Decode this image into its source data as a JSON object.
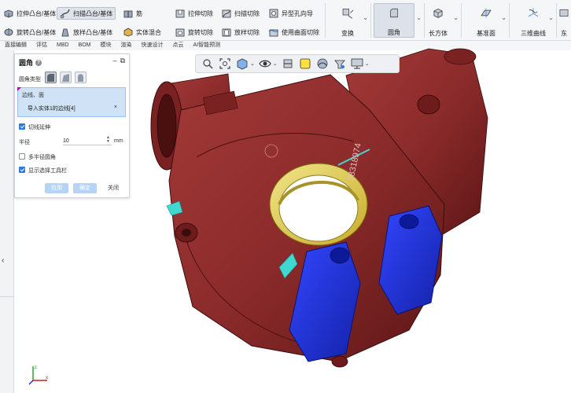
{
  "ribbon": {
    "row1": [
      {
        "label": "拉伸凸台/基体",
        "icon": "extrude-boss-icon"
      },
      {
        "label": "扫描凸台/基体",
        "icon": "sweep-boss-icon",
        "active": true
      },
      {
        "label": "筋",
        "icon": "rib-icon"
      },
      {
        "label": "拉伸切除",
        "icon": "extrude-cut-icon"
      },
      {
        "label": "扫描切除",
        "icon": "sweep-cut-icon"
      },
      {
        "label": "异型孔向导",
        "icon": "hole-wizard-icon"
      }
    ],
    "row2": [
      {
        "label": "旋转凸台/基体",
        "icon": "revolve-boss-icon"
      },
      {
        "label": "放样凸台/基体",
        "icon": "loft-boss-icon"
      },
      {
        "label": "实体混合",
        "icon": "solid-blend-icon"
      },
      {
        "label": "旋转切除",
        "icon": "revolve-cut-icon"
      },
      {
        "label": "放样切除",
        "icon": "loft-cut-icon"
      },
      {
        "label": "使用曲面切除",
        "icon": "surface-cut-icon"
      }
    ],
    "big": [
      {
        "label": "变换",
        "icon": "transform-icon"
      },
      {
        "label": "圆角",
        "icon": "fillet-icon",
        "active": true
      },
      {
        "label": "长方体",
        "icon": "box-icon"
      },
      {
        "label": "基准面",
        "icon": "plane-icon"
      },
      {
        "label": "三维曲线",
        "icon": "3d-curve-icon"
      },
      {
        "label": "东",
        "icon": "more-icon"
      }
    ]
  },
  "tabs": [
    "直接编辑",
    "评估",
    "MBD",
    "BOM",
    "模块",
    "渲染",
    "快速设计",
    "点云",
    "AI智能预测"
  ],
  "panel": {
    "title": "圆角",
    "fillet_type_label": "圆角类型",
    "selection_title": "边线、面",
    "selection_item": "导入实体1的边线[4]",
    "remove_symbol": "×",
    "tangent_propagation": "切线延伸",
    "radius_label": "半径",
    "radius_value": "10",
    "radius_unit": "mm",
    "multi_radius": "多半径圆角",
    "show_toolbar": "显示选择工具栏",
    "apply": "应用",
    "ok": "确定",
    "close": "关闭",
    "checks": {
      "tangent_propagation": true,
      "multi_radius": false,
      "show_toolbar": true
    }
  },
  "colors": {
    "part_body": "#8c2b2b",
    "part_dark": "#5e1616",
    "bearing_face": "#e2d04a",
    "selected_face": "#1830d8",
    "highlight_edge": "#3fd9d2",
    "accent": "#2b7de0"
  }
}
